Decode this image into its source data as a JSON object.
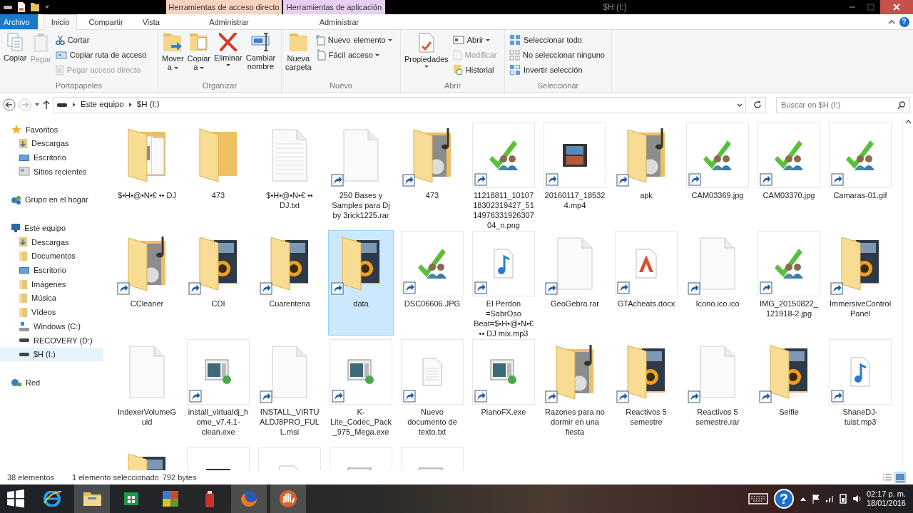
{
  "window": {
    "title": "$H (I:)"
  },
  "context_groups": [
    {
      "title": "Herramientas de acceso directo",
      "color": "#f8d3c0",
      "tabs": [
        {
          "label": "Administrar",
          "selected": false
        }
      ]
    },
    {
      "title": "Herramientas de aplicación",
      "color": "#e6cff0",
      "tabs": [
        {
          "label": "Administrar",
          "selected": false
        }
      ]
    }
  ],
  "tabs": [
    {
      "label": "Archivo",
      "kind": "file",
      "selected": false
    },
    {
      "label": "Inicio",
      "kind": "tab",
      "selected": true
    },
    {
      "label": "Compartir",
      "kind": "tab",
      "selected": false
    },
    {
      "label": "Vista",
      "kind": "tab",
      "selected": false
    }
  ],
  "ribbon": [
    {
      "label": "Portapapeles",
      "items": [
        {
          "kind": "large",
          "label": "Copiar",
          "disabled": false,
          "menu": false
        },
        {
          "kind": "large",
          "label": "Pegar",
          "disabled": true,
          "menu": false
        },
        {
          "kind": "stack",
          "rows": [
            {
              "label": "Cortar",
              "disabled": false,
              "menu": false
            },
            {
              "label": "Copiar ruta de acceso",
              "disabled": false,
              "menu": false
            },
            {
              "label": "Pegar acceso directo",
              "disabled": true,
              "menu": false
            }
          ]
        }
      ]
    },
    {
      "label": "Organizar",
      "items": [
        {
          "kind": "large",
          "label": "Mover a",
          "disabled": false,
          "menu": true
        },
        {
          "kind": "large",
          "label": "Copiar a",
          "disabled": false,
          "menu": true
        },
        {
          "kind": "large",
          "label": "Eliminar",
          "disabled": false,
          "menu": true
        },
        {
          "kind": "large",
          "label": "Cambiar nombre",
          "disabled": false,
          "menu": false
        }
      ]
    },
    {
      "label": "Nuevo",
      "items": [
        {
          "kind": "large",
          "label": "Nueva carpeta",
          "disabled": false,
          "menu": false
        },
        {
          "kind": "stack",
          "rows": [
            {
              "label": "Nuevo elemento",
              "disabled": false,
              "menu": true
            },
            {
              "label": "Fácil acceso",
              "disabled": false,
              "menu": true
            }
          ]
        }
      ]
    },
    {
      "label": "Abrir",
      "items": [
        {
          "kind": "large",
          "label": "Propiedades",
          "disabled": false,
          "menu": true
        },
        {
          "kind": "stack",
          "rows": [
            {
              "label": "Abrir",
              "disabled": false,
              "menu": true
            },
            {
              "label": "Modificar",
              "disabled": true,
              "menu": false
            },
            {
              "label": "Historial",
              "disabled": false,
              "menu": false
            }
          ]
        }
      ]
    },
    {
      "label": "Seleccionar",
      "items": [
        {
          "kind": "stack",
          "rows": [
            {
              "label": "Seleccionar todo",
              "disabled": false,
              "menu": false
            },
            {
              "label": "No seleccionar ninguno",
              "disabled": false,
              "menu": false
            },
            {
              "label": "Invertir selección",
              "disabled": false,
              "menu": false
            }
          ]
        }
      ]
    }
  ],
  "ribbon_help": "?",
  "address": {
    "breadcrumbs": [
      "Este equipo",
      "$H (I:)"
    ],
    "search": {
      "placeholder": "Buscar en $H (I:)"
    }
  },
  "sidebar": [
    {
      "label": "Favoritos",
      "kind": "star",
      "selected": false,
      "children": [
        {
          "label": "Descargas",
          "kind": "downloads",
          "selected": false
        },
        {
          "label": "Escritorio",
          "kind": "desktop",
          "selected": false
        },
        {
          "label": "Sitios recientes",
          "kind": "recent",
          "selected": false
        }
      ]
    },
    {
      "label": "Grupo en el hogar",
      "kind": "homegroup",
      "selected": false
    },
    {
      "label": "Este equipo",
      "kind": "computer",
      "selected": false,
      "children": [
        {
          "label": "Descargas",
          "kind": "downloads",
          "selected": false
        },
        {
          "label": "Documentos",
          "kind": "folder",
          "selected": false
        },
        {
          "label": "Escritorio",
          "kind": "desktop",
          "selected": false
        },
        {
          "label": "Imágenes",
          "kind": "folder",
          "selected": false
        },
        {
          "label": "Música",
          "kind": "folder",
          "selected": false
        },
        {
          "label": "Vídeos",
          "kind": "folder",
          "selected": false
        },
        {
          "label": "Windows (C:)",
          "kind": "windrive",
          "selected": false
        },
        {
          "label": "RECOVERY (D:)",
          "kind": "drive",
          "selected": false
        },
        {
          "label": "$H (I:)",
          "kind": "drive",
          "selected": true
        }
      ]
    },
    {
      "label": "Red",
      "kind": "network",
      "selected": false
    }
  ],
  "files": [
    {
      "name": "$•H•@•N•€ •• DJ",
      "kind": "folder-docs",
      "shortcut": false,
      "selected": false
    },
    {
      "name": "473",
      "kind": "folder",
      "shortcut": false,
      "selected": false
    },
    {
      "name": "$•H•@•N•€ •• DJ.txt",
      "kind": "text",
      "shortcut": false,
      "selected": false
    },
    {
      "name": "250 Bases y Samples para Dj by 3rick1225.rar",
      "kind": "blank",
      "shortcut": true,
      "selected": false
    },
    {
      "name": "473",
      "kind": "folder-music",
      "shortcut": true,
      "selected": false
    },
    {
      "name": "11218811_1010718302319427_511497633192630704_n.png",
      "kind": "image",
      "shortcut": true,
      "selected": false
    },
    {
      "name": "20160117_185324.mp4",
      "kind": "video",
      "shortcut": true,
      "selected": false
    },
    {
      "name": "apk",
      "kind": "folder-music",
      "shortcut": true,
      "selected": false
    },
    {
      "name": "CAM03369.jpg",
      "kind": "image",
      "shortcut": true,
      "selected": false
    },
    {
      "name": "CAM03370.jpg",
      "kind": "image",
      "shortcut": true,
      "selected": false
    },
    {
      "name": "Camaras-01.gif",
      "kind": "image",
      "shortcut": true,
      "selected": false
    },
    {
      "name": "CCleaner",
      "kind": "folder-music",
      "shortcut": true,
      "selected": false
    },
    {
      "name": "CDI",
      "kind": "folder-media",
      "shortcut": true,
      "selected": false
    },
    {
      "name": "Cuarentena",
      "kind": "folder-media",
      "shortcut": true,
      "selected": false
    },
    {
      "name": "data",
      "kind": "folder-media",
      "shortcut": true,
      "selected": true
    },
    {
      "name": "DSC06606.JPG",
      "kind": "image",
      "shortcut": true,
      "selected": false
    },
    {
      "name": "El Perdon =SabrOso Beat=$•H•@•N•€ •• DJ mix.mp3",
      "kind": "music",
      "shortcut": true,
      "selected": false
    },
    {
      "name": "GeoGebra.rar",
      "kind": "blank",
      "shortcut": true,
      "selected": false
    },
    {
      "name": "GTAcheats.docx",
      "kind": "doc",
      "shortcut": true,
      "selected": false
    },
    {
      "name": "Icono.ico.ico",
      "kind": "blank",
      "shortcut": true,
      "selected": false
    },
    {
      "name": "IMG_20150822_121918-2.jpg",
      "kind": "image",
      "shortcut": true,
      "selected": false
    },
    {
      "name": "ImmersiveControlPanel",
      "kind": "folder-media",
      "shortcut": true,
      "selected": false
    },
    {
      "name": "IndexerVolumeGuid",
      "kind": "blank",
      "shortcut": false,
      "selected": false
    },
    {
      "name": "install_virtualdj_home_v7.4.1-clean.exe",
      "kind": "program",
      "shortcut": true,
      "selected": false
    },
    {
      "name": "INSTALL_VIRTUALDJ8PRO_FULL.msi",
      "kind": "blank",
      "shortcut": true,
      "selected": false
    },
    {
      "name": "K-Lite_Codec_Pack_975_Mega.exe",
      "kind": "program",
      "shortcut": true,
      "selected": false
    },
    {
      "name": "Nuevo documento de texto.txt",
      "kind": "note",
      "shortcut": true,
      "selected": false
    },
    {
      "name": "PianoFX.exe",
      "kind": "program",
      "shortcut": true,
      "selected": false
    },
    {
      "name": "Razones para no dormir en una fiesta",
      "kind": "folder-music",
      "shortcut": true,
      "selected": false
    },
    {
      "name": "Reactivos 5 semestre",
      "kind": "folder-media",
      "shortcut": true,
      "selected": false
    },
    {
      "name": "Reactivos 5 semestre.rar",
      "kind": "blank",
      "shortcut": true,
      "selected": false
    },
    {
      "name": "Selfie",
      "kind": "folder-media",
      "shortcut": true,
      "selected": false
    },
    {
      "name": "ShaneDJ-tuist.mp3",
      "kind": "music",
      "shortcut": true,
      "selected": false
    },
    {
      "kind": "folder-media",
      "shortcut": false,
      "selected": false
    },
    {
      "kind": "video",
      "shortcut": false,
      "selected": false
    },
    {
      "kind": "doc",
      "shortcut": false,
      "selected": false
    },
    {
      "kind": "program",
      "shortcut": false,
      "selected": false
    },
    {
      "kind": "program",
      "shortcut": false,
      "selected": false
    }
  ],
  "status_bar": {
    "count": "38 elementos",
    "selection": "1 elemento seleccionado",
    "size": "792 bytes",
    "views": [
      {
        "kind": "details",
        "selected": false
      },
      {
        "kind": "icons",
        "selected": true
      }
    ]
  },
  "taskbar": {
    "apps": [
      {
        "kind": "start",
        "running": false
      },
      {
        "kind": "browser",
        "running": false
      },
      {
        "kind": "explorer",
        "running": true
      },
      {
        "kind": "store",
        "running": false
      },
      {
        "kind": "tiles",
        "running": false
      },
      {
        "kind": "red",
        "running": false
      },
      {
        "kind": "firefox",
        "running": true
      },
      {
        "kind": "hand",
        "running": true
      }
    ],
    "help": "?",
    "time": "02:17 p. m.",
    "date": "18/01/2016"
  }
}
